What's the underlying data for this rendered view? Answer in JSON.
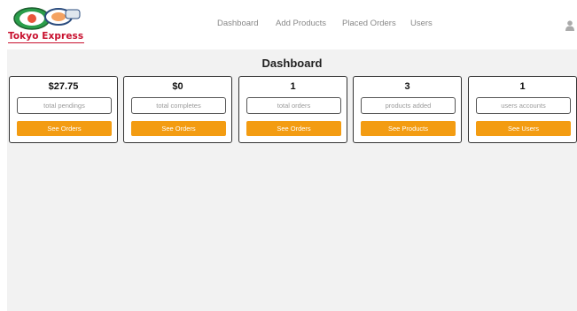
{
  "logo": {
    "text": "Tokyo Express"
  },
  "nav": {
    "items": [
      {
        "label": "Dashboard"
      },
      {
        "label": "Add Products"
      },
      {
        "label": "Placed Orders"
      },
      {
        "label": "Users"
      }
    ]
  },
  "user_icon": "user-icon",
  "page": {
    "title": "Dashboard"
  },
  "cards": [
    {
      "value": "$27.75",
      "label": "total pendings",
      "button": "See Orders"
    },
    {
      "value": "$0",
      "label": "total completes",
      "button": "See Orders"
    },
    {
      "value": "1",
      "label": "total orders",
      "button": "See Orders"
    },
    {
      "value": "3",
      "label": "products added",
      "button": "See Products"
    },
    {
      "value": "1",
      "label": "users accounts",
      "button": "See Users"
    }
  ],
  "colors": {
    "accent": "#f39c12",
    "brand": "#c8102e",
    "background": "#f2f2f2"
  }
}
